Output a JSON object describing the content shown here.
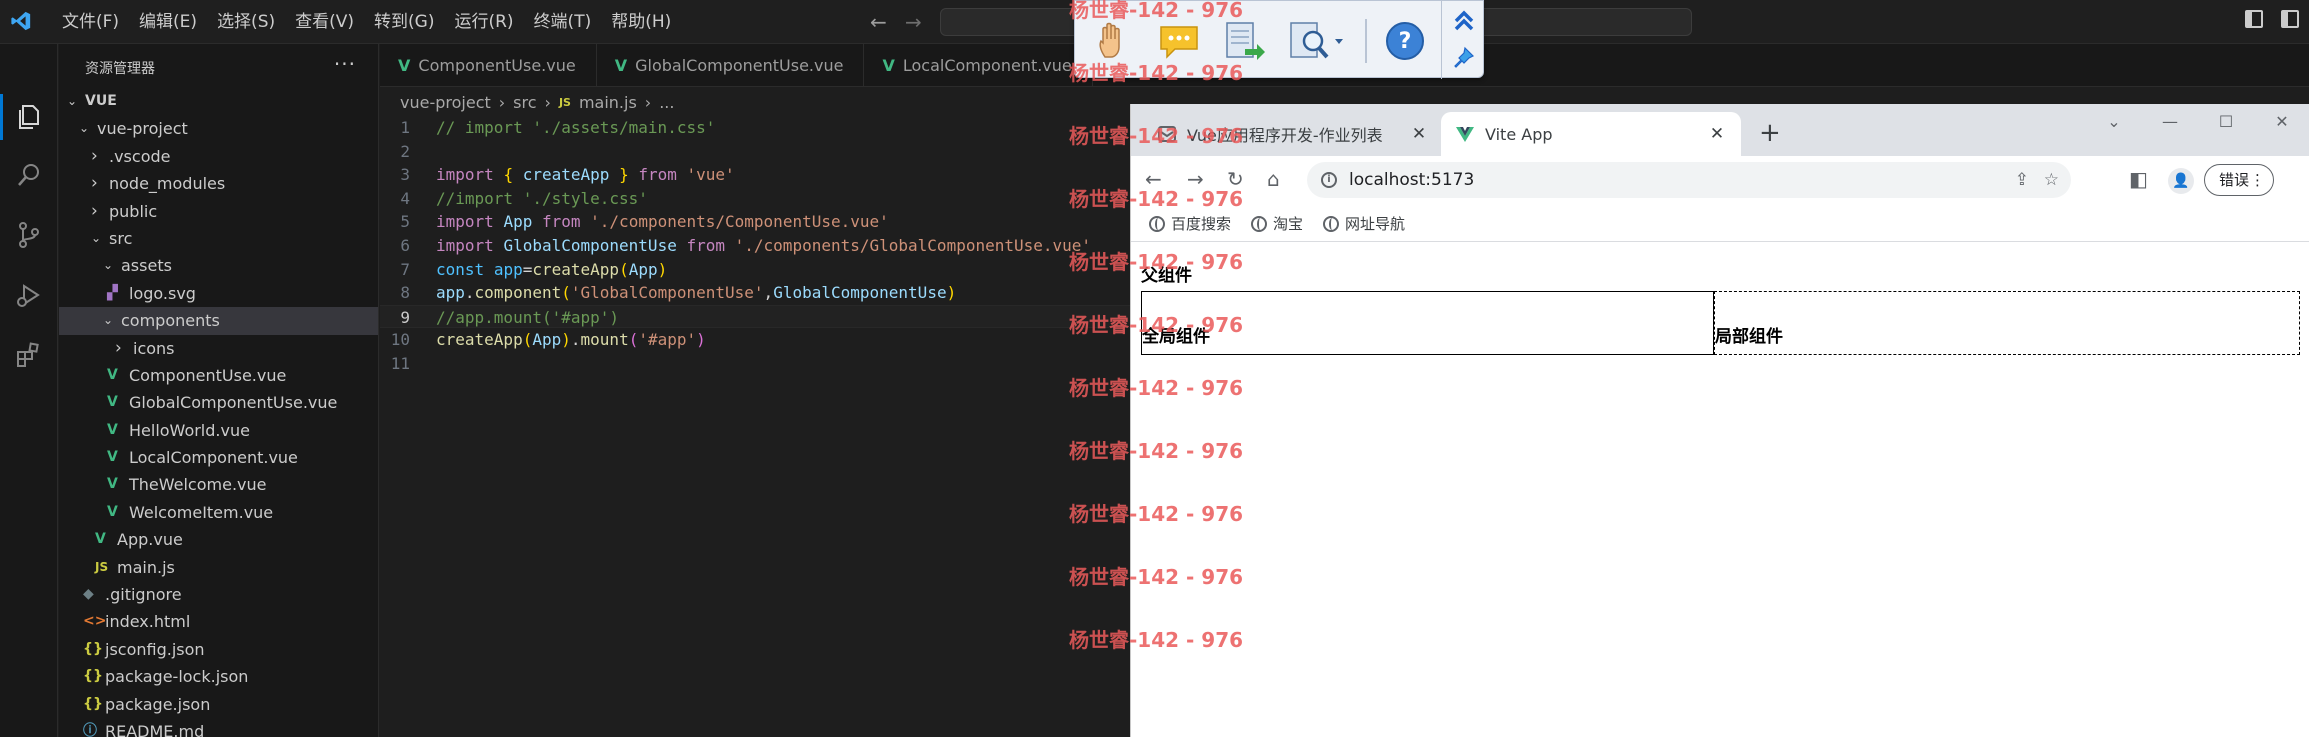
{
  "menubar": {
    "items": [
      "文件(F)",
      "编辑(E)",
      "选择(S)",
      "查看(V)",
      "转到(G)",
      "运行(R)",
      "终端(T)",
      "帮助(H)"
    ]
  },
  "sidebar": {
    "title": "资源管理器",
    "tree": [
      {
        "label": "VUE",
        "depth": 0,
        "type": "root",
        "expanded": true
      },
      {
        "label": "vue-project",
        "depth": 1,
        "type": "folder",
        "expanded": true
      },
      {
        "label": ".vscode",
        "depth": 2,
        "type": "folder",
        "expanded": false
      },
      {
        "label": "node_modules",
        "depth": 2,
        "type": "folder",
        "expanded": false
      },
      {
        "label": "public",
        "depth": 2,
        "type": "folder",
        "expanded": false
      },
      {
        "label": "src",
        "depth": 2,
        "type": "folder",
        "expanded": true
      },
      {
        "label": "assets",
        "depth": 3,
        "type": "folder",
        "expanded": true
      },
      {
        "label": "logo.svg",
        "depth": 4,
        "type": "svg"
      },
      {
        "label": "components",
        "depth": 3,
        "type": "folder",
        "expanded": true,
        "selected": true
      },
      {
        "label": "icons",
        "depth": 4,
        "type": "folder",
        "expanded": false
      },
      {
        "label": "ComponentUse.vue",
        "depth": 4,
        "type": "vue"
      },
      {
        "label": "GlobalComponentUse.vue",
        "depth": 4,
        "type": "vue"
      },
      {
        "label": "HelloWorld.vue",
        "depth": 4,
        "type": "vue"
      },
      {
        "label": "LocalComponent.vue",
        "depth": 4,
        "type": "vue"
      },
      {
        "label": "TheWelcome.vue",
        "depth": 4,
        "type": "vue"
      },
      {
        "label": "WelcomeItem.vue",
        "depth": 4,
        "type": "vue"
      },
      {
        "label": "App.vue",
        "depth": 3,
        "type": "vue"
      },
      {
        "label": "main.js",
        "depth": 3,
        "type": "js"
      },
      {
        "label": ".gitignore",
        "depth": 2,
        "type": "git"
      },
      {
        "label": "index.html",
        "depth": 2,
        "type": "html"
      },
      {
        "label": "jsconfig.json",
        "depth": 2,
        "type": "json"
      },
      {
        "label": "package-lock.json",
        "depth": 2,
        "type": "json"
      },
      {
        "label": "package.json",
        "depth": 2,
        "type": "json"
      },
      {
        "label": "README.md",
        "depth": 2,
        "type": "info"
      }
    ]
  },
  "editor_tabs": [
    {
      "label": "ComponentUse.vue",
      "active": false
    },
    {
      "label": "GlobalComponentUse.vue",
      "active": false
    },
    {
      "label": "LocalComponent.vue",
      "active": false
    }
  ],
  "breadcrumb": {
    "parts": [
      "vue-project",
      "src",
      "main.js",
      "..."
    ],
    "js_badge": "JS"
  },
  "code": {
    "current_line": 9,
    "lines": [
      {
        "num": "1",
        "tokens": [
          [
            "comment",
            "// import './assets/main.css'"
          ]
        ]
      },
      {
        "num": "2",
        "tokens": []
      },
      {
        "num": "3",
        "tokens": [
          [
            "kw",
            "import"
          ],
          [
            "plain",
            " "
          ],
          [
            "brace",
            "{"
          ],
          [
            "plain",
            " "
          ],
          [
            "var",
            "createApp"
          ],
          [
            "plain",
            " "
          ],
          [
            "brace",
            "}"
          ],
          [
            "plain",
            " "
          ],
          [
            "kw",
            "from"
          ],
          [
            "plain",
            " "
          ],
          [
            "str",
            "'vue'"
          ]
        ]
      },
      {
        "num": "4",
        "tokens": [
          [
            "comment",
            "//import './style.css'"
          ]
        ]
      },
      {
        "num": "5",
        "tokens": [
          [
            "kw",
            "import"
          ],
          [
            "plain",
            " "
          ],
          [
            "var",
            "App"
          ],
          [
            "plain",
            " "
          ],
          [
            "kw",
            "from"
          ],
          [
            "plain",
            " "
          ],
          [
            "str",
            "'./components/ComponentUse.vue'"
          ]
        ]
      },
      {
        "num": "6",
        "tokens": [
          [
            "kw",
            "import"
          ],
          [
            "plain",
            " "
          ],
          [
            "var",
            "GlobalComponentUse"
          ],
          [
            "plain",
            " "
          ],
          [
            "kw",
            "from"
          ],
          [
            "plain",
            " "
          ],
          [
            "str",
            "'./components/GlobalComponentUse.vue'"
          ]
        ]
      },
      {
        "num": "7",
        "tokens": [
          [
            "type",
            "const"
          ],
          [
            "plain",
            " "
          ],
          [
            "type",
            "app"
          ],
          [
            "plain",
            "="
          ],
          [
            "fn",
            "createApp"
          ],
          [
            "brace",
            "("
          ],
          [
            "var",
            "App"
          ],
          [
            "brace",
            ")"
          ]
        ]
      },
      {
        "num": "8",
        "tokens": [
          [
            "var",
            "app"
          ],
          [
            "plain",
            "."
          ],
          [
            "fn",
            "component"
          ],
          [
            "brace",
            "("
          ],
          [
            "str",
            "'GlobalComponentUse'"
          ],
          [
            "plain",
            ","
          ],
          [
            "var",
            "GlobalComponentUse"
          ],
          [
            "brace",
            ")"
          ]
        ]
      },
      {
        "num": "9",
        "tokens": [
          [
            "comment",
            "//app.mount('#app')"
          ]
        ]
      },
      {
        "num": "10",
        "tokens": [
          [
            "fn",
            "createApp"
          ],
          [
            "brace",
            "("
          ],
          [
            "var",
            "App"
          ],
          [
            "brace",
            ")"
          ],
          [
            "plain",
            "."
          ],
          [
            "fn",
            "mount"
          ],
          [
            "paren",
            "("
          ],
          [
            "str",
            "'#app'"
          ],
          [
            "paren",
            ")"
          ]
        ]
      },
      {
        "num": "11",
        "tokens": []
      }
    ]
  },
  "browser": {
    "tabs": [
      {
        "title": "Vue应用程序开发-作业列表",
        "active": false
      },
      {
        "title": "Vite App",
        "active": true
      }
    ],
    "new_tab": "+",
    "url": "localhost:5173",
    "error_button": "错误",
    "bookmarks": [
      "百度搜索",
      "淘宝",
      "网址导航"
    ],
    "page": {
      "parent_heading": "父组件",
      "global_component_label": "全局组件",
      "local_component_label": "局部组件"
    }
  },
  "watermark": {
    "text": "杨世睿-142 - 976",
    "count": 11
  },
  "colors": {
    "accent": "#0078d4",
    "vue_green": "#41b883",
    "watermark_red": "#ea5a5a"
  }
}
